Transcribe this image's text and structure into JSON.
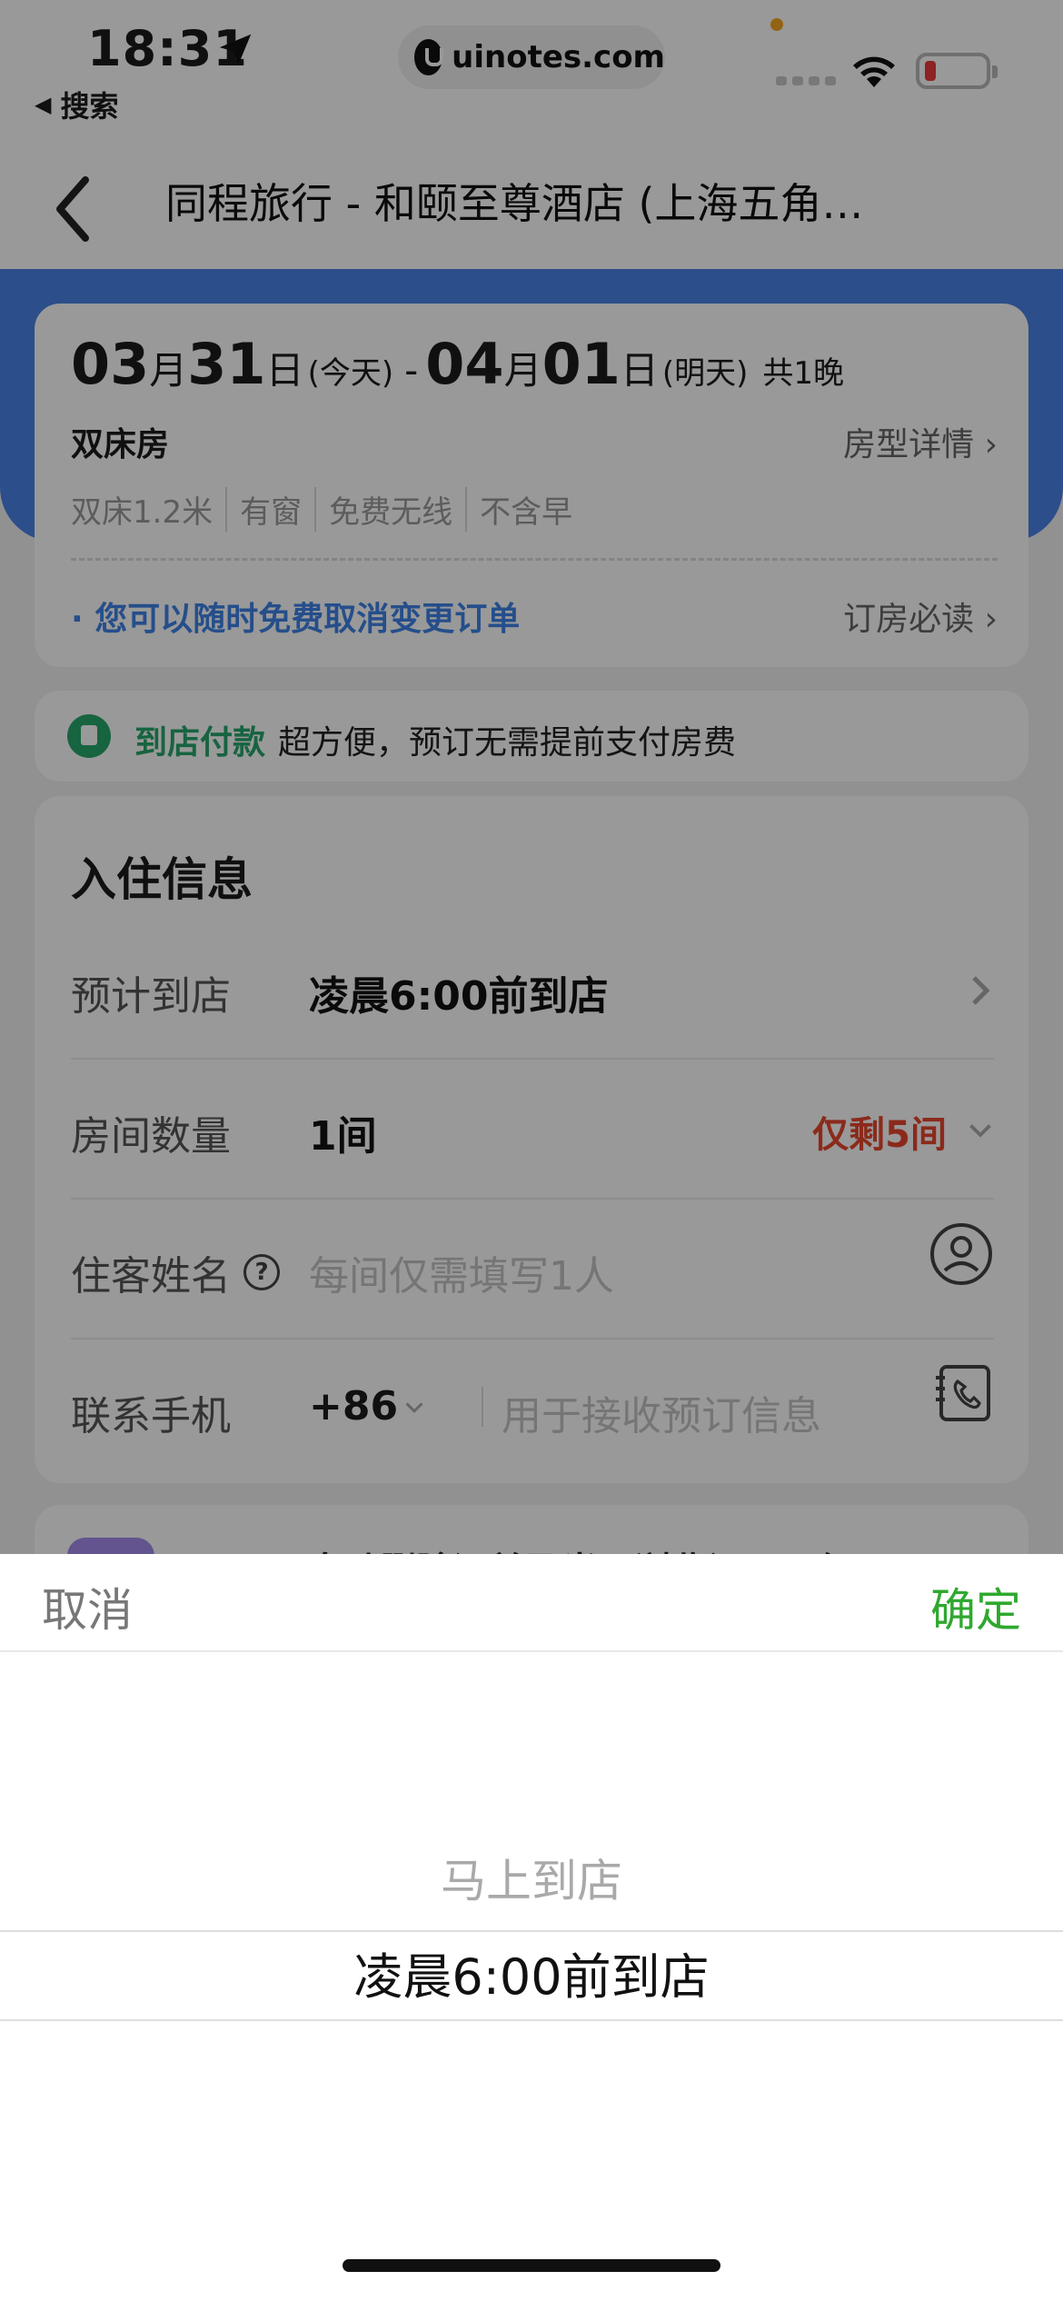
{
  "status_bar": {
    "time": "18:31",
    "back_app_label": "搜索",
    "url": "uinotes.com",
    "icons": [
      "location-arrow-icon",
      "signal-icon",
      "wifi-icon",
      "battery-icon"
    ],
    "battery_color": "#eb3b3b"
  },
  "nav": {
    "title": "同程旅行 - 和颐至尊酒店 (上海五角…"
  },
  "room": {
    "check_in": {
      "month": "03",
      "month_unit": "月",
      "day": "31",
      "day_unit": "日",
      "note": "(今天)"
    },
    "separator": "-",
    "check_out": {
      "month": "04",
      "month_unit": "月",
      "day": "01",
      "day_unit": "日",
      "note": "(明天)"
    },
    "nights": "共1晚",
    "type": "双床房",
    "detail_link": "房型详情",
    "tags": [
      "双床1.2米",
      "有窗",
      "免费无线",
      "不含早"
    ],
    "cancel_policy": "· 您可以随时免费取消变更订单",
    "booking_notes": "订房必读"
  },
  "payment": {
    "title": "到店付款",
    "desc": "超方便，预订无需提前支付房费",
    "accent": "#27a76b"
  },
  "checkin": {
    "title": "入住信息",
    "arrival": {
      "label": "预计到店",
      "value": "凌晨6:00前到店"
    },
    "rooms": {
      "label": "房间数量",
      "value": "1间",
      "stock_warning": "仅剩5间"
    },
    "guest": {
      "label": "住客姓名",
      "placeholder": "每间仅需填写1人"
    },
    "phone": {
      "label": "联系手机",
      "country_code": "+86",
      "placeholder": "用于接收预订信息"
    }
  },
  "promo": {
    "text": "自动删除证单及当日浏览记录，仅"
  },
  "picker": {
    "cancel": "取消",
    "confirm": "确定",
    "options": [
      "马上到店",
      "凌晨6:00前到店"
    ],
    "selected": "凌晨6:00前到店",
    "confirm_color": "#2fa82f"
  },
  "colors": {
    "brand_blue": "#4a82e6",
    "link_blue": "#3f82e8",
    "warning_red": "#e8472e"
  }
}
